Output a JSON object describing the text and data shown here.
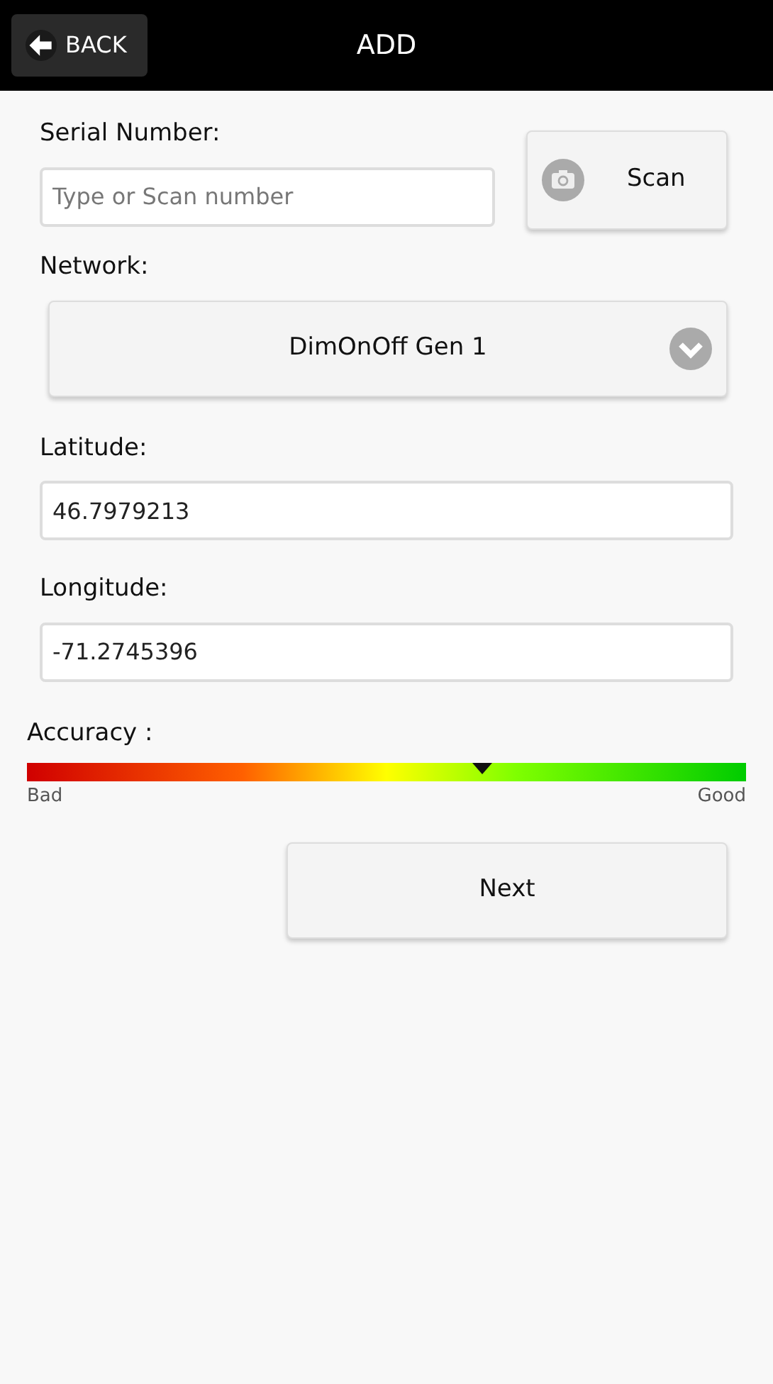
{
  "header": {
    "back_label": "BACK",
    "title": "ADD"
  },
  "serial": {
    "label": "Serial Number:",
    "placeholder": "Type or Scan number",
    "scan_label": "Scan"
  },
  "network": {
    "label": "Network:",
    "value": "DimOnOff Gen 1"
  },
  "latitude": {
    "label": "Latitude:",
    "value": "46.7979213"
  },
  "longitude": {
    "label": "Longitude:",
    "value": "-71.2745396"
  },
  "accuracy": {
    "label": "Accuracy :",
    "level": 0.634,
    "low_label": "Bad",
    "high_label": "Good"
  },
  "next_label": "Next"
}
